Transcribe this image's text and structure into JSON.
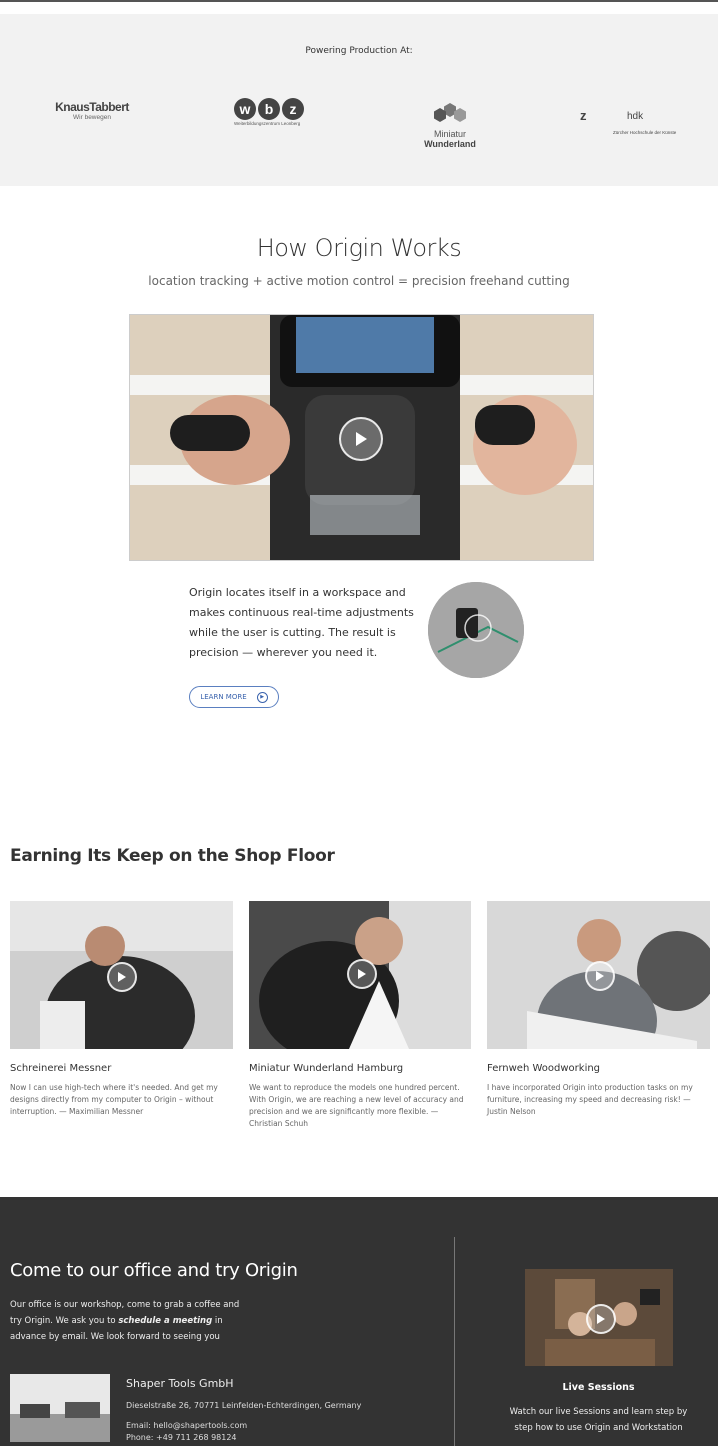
{
  "powering": {
    "label": "Powering Production At:",
    "logos": {
      "knaus_name": "KnausTabbert",
      "knaus_sub": "Wir bewegen",
      "wbz_letters": [
        "w",
        "b",
        "z"
      ],
      "wbz_sub": "Weiterbildungszentrum Leonberg",
      "mini_line1": "Miniatur",
      "mini_line2": "Wunderland",
      "hdk_z": "z",
      "hdk_h": "hdk",
      "hdk_sub": "Zürcher Hochschule der Künste"
    }
  },
  "how": {
    "title": "How Origin Works",
    "subtitle": "location tracking + active motion control = precision freehand cutting",
    "description": "Origin locates itself in a workspace and makes continuous real-time adjustments while the user is cutting. The result is precision — wherever you need it.",
    "learn_more": "LEARN MORE"
  },
  "earning": {
    "title": "Earning Its Keep on the Shop Floor",
    "cards": [
      {
        "name": "Schreinerei Messner",
        "quote": "Now I can use high-tech where it's needed. And get my designs directly from my computer to Origin – without interruption. — Maximilian Messner"
      },
      {
        "name": "Miniatur Wunderland Hamburg",
        "quote": "We want to reproduce the models one hundred percent. With Origin, we are reaching a new level of accuracy and precision and we are significantly more flexible. — Christian Schuh"
      },
      {
        "name": "Fernweh Woodworking",
        "quote": "I have incorporated Origin into production tasks on my furniture, increasing my speed and decreasing risk! — Justin Nelson"
      }
    ]
  },
  "footer": {
    "title": "Come to our office and try Origin",
    "text_before": "Our office is our workshop, come to grab a coffee and try Origin. We ask you to ",
    "text_bold": "schedule a meeting",
    "text_after": " in advance by email. We look forward to seeing you",
    "company": "Shaper Tools GmbH",
    "address": "Dieselstraße 26, 70771 Leinfelden-Echterdingen, Germany",
    "email": "Email: hello@shapertools.com",
    "phone": "Phone: +49 711 268 98124",
    "live_title": "Live Sessions",
    "live_text": "Watch our live Sessions and learn step by step how to use Origin and Workstation"
  },
  "colors": {
    "footer_bg": "#333333",
    "accent": "#3a63ad",
    "section_bg": "#f2f2f2"
  }
}
